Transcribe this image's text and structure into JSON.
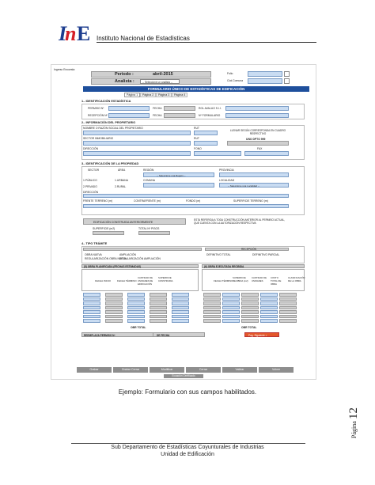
{
  "header": {
    "logo_text": "INE",
    "institution": "Instituto Nacional de Estadísticas"
  },
  "form": {
    "ingreso_label": "Ingreso Encuesta",
    "periodo_label": "Periodo :",
    "periodo_value": "abril-2015",
    "analista_label": "Analista :",
    "analista_placeholder": "-- Seleccione un analista --",
    "folio_label": "Folio",
    "comuna_label": "Cód.Comuna",
    "title": "FORMULARIO ÚNICO DE ESTADÍSTICAS DE EDIFICACIÓN",
    "tabs": [
      "Página 1",
      "Página 2",
      "Página 3",
      "Página 4"
    ],
    "s1_title": "1.- IDENTIFICACIÓN ESTADÍSTICA",
    "s1_fields": [
      "PERMISO Nº",
      "FECHA",
      "ROL AVALUO S.I.I.",
      "RECEPCIÓN Nº",
      "FECHA",
      "Nº FORMULARIO"
    ],
    "s2_title": "2.- INFORMACIÓN DEL PROPIETARIO",
    "s2_fields": [
      "NOMBRE O RAZÓN SOCIAL DEL PROPIETARIO",
      "RUT",
      "SECTOR INMOBILIARIO",
      "RUT",
      "DIRECCIÓN",
      "FONO",
      "FAX"
    ],
    "s2_note": "LLENAR SEGÚN CORRESPONDA EN CUADRO RESPECTIVO",
    "s2_code": "UNO DPTO 999",
    "s3_title": "3.- IDENTIFICACIÓN DE LA PROPIEDAD",
    "s3_fields": [
      "SECTOR",
      "ÁREA",
      "REGIÓN",
      "PROVINCIA",
      "1.PÚBLICO",
      "1.URBANA",
      "2.PRIVADO",
      "2.RURAL",
      "COMUNA",
      "LOCALIDAD",
      "DIRECCIÓN",
      "FRENTE TERRENO (m)",
      "CONTRAFRENTE (m)",
      "FONDO (m)",
      "SUPERFICIE TERRENO (m)"
    ],
    "s3_region_placeholder": "-- Seleccione una Región --",
    "s3_localidad_placeholder": "-- Seleccione una Localidad --",
    "s3_anterior": "EDIFICACIÓN CONSTRUIDA ANTERIORMENTE",
    "s3_anterior_note": "ESTA REFERIDA A TODA CONSTRUCCIÓN ANTERIOR AL PERMISO ACTUAL, QUE CUENTA CON LA AUTORIZACIÓN RESPECTIVA",
    "s3_sup_label": "SUPERFICIE (m2)",
    "s3_total_label": "TOTAL Nº PISOS",
    "s4_title": "4.- TIPO TRÁMITE",
    "s4_options": [
      "OBRA NUEVA",
      "AMPLIACIÓN",
      "REGULARIZACIÓN OBRA NUEVA",
      "REGULARIZACIÓN AMPLIACIÓN",
      "DEFINITIVO TOTAL",
      "DEFINITIVO PARCIAL"
    ],
    "s4_recepcion": "RECEPCIÓN",
    "s5_title_a": "(5) OBRA PLANIFICADA (FECHAS ESTIMADAS)",
    "s5_title_b": "(6) OBRA EJECUTADA RECIBIDA",
    "s5_headers_a": [
      "FECHA INICIO",
      "FECHA TÉRMINO",
      "CANTIDAD DE UNIDADES DE EDIFICACIÓN",
      "SUPERFICIE CONSTRUIDA"
    ],
    "s5_headers_b": [
      "FECHA TÉRMINO",
      "SUPERFICIE RECIBIDA (m2)",
      "CANTIDAD DE UNIDADES",
      "COSTO TOTAL DE OBRA",
      "CLASIFICACIÓN DE LA OBRA"
    ],
    "total_label": "OBR TOTAL",
    "reemplaza_label": "REEMPLAZA PERMISO Nº",
    "de_fecha_label": "DE FECHA",
    "pag_label": "Pag. Siguiente >",
    "buttons": [
      "Grabar",
      "Grabar Cerrar",
      "Modificar",
      "Cerrar",
      "Validar",
      "Volver"
    ],
    "bottom_button": "Ecuación Certificado"
  },
  "caption": "Ejemplo: Formulario con sus campos habilitados.",
  "page": {
    "label": "Página",
    "number": "12"
  },
  "footer": {
    "line1": "Sub Departamento de Estadísticas Coyunturales de Industrias",
    "line2": "Unidad de Edificación"
  },
  "colors": {
    "brand_blue": "#1d3d8f",
    "brand_red": "#d62027",
    "form_blue": "#c9dcf2",
    "title_blue": "#1e4f9c"
  }
}
